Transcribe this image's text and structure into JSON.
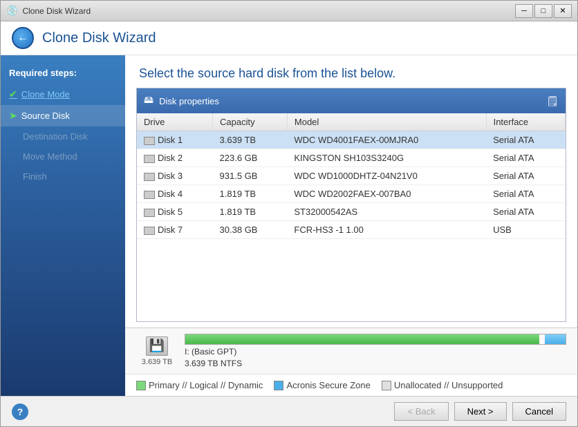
{
  "titlebar": {
    "title": "Clone Disk Wizard",
    "icon": "💿",
    "min_btn": "─",
    "max_btn": "□",
    "close_btn": "✕"
  },
  "app_header": {
    "title": "Clone Disk Wizard"
  },
  "sidebar": {
    "header": "Required steps:",
    "items": [
      {
        "id": "clone-mode",
        "label": "Clone Mode",
        "state": "done"
      },
      {
        "id": "source-disk",
        "label": "Source Disk",
        "state": "active"
      },
      {
        "id": "destination-disk",
        "label": "Destination Disk",
        "state": "disabled"
      },
      {
        "id": "move-method",
        "label": "Move Method",
        "state": "disabled"
      },
      {
        "id": "finish",
        "label": "Finish",
        "state": "disabled"
      }
    ]
  },
  "content": {
    "header": "Select the source hard disk from the list below.",
    "panel_title": "Disk properties",
    "table": {
      "columns": [
        "Drive",
        "Capacity",
        "Model",
        "Interface"
      ],
      "rows": [
        {
          "drive": "Disk 1",
          "capacity": "3.639 TB",
          "model": "WDC WD4001FAEX-00MJRA0",
          "interface": "Serial ATA"
        },
        {
          "drive": "Disk 2",
          "capacity": "223.6 GB",
          "model": "KINGSTON SH103S3240G",
          "interface": "Serial ATA"
        },
        {
          "drive": "Disk 3",
          "capacity": "931.5 GB",
          "model": "WDC WD1000DHTZ-04N21V0",
          "interface": "Serial ATA"
        },
        {
          "drive": "Disk 4",
          "capacity": "1.819 TB",
          "model": "WDC WD2002FAEX-007BA0",
          "interface": "Serial ATA"
        },
        {
          "drive": "Disk 5",
          "capacity": "1.819 TB",
          "model": "ST32000542AS",
          "interface": "Serial ATA"
        },
        {
          "drive": "Disk 7",
          "capacity": "30.38 GB",
          "model": "FCR-HS3 -1 1.00",
          "interface": "USB"
        }
      ]
    },
    "disk_display": {
      "size": "3.639 TB",
      "label": "I: (Basic GPT)",
      "sublabel": "3.639 TB  NTFS",
      "fill_percent": 93
    },
    "legend": [
      {
        "id": "primary",
        "label": "Primary // Logical // Dynamic",
        "color": "primary"
      },
      {
        "id": "acronis",
        "label": "Acronis Secure Zone",
        "color": "acronis"
      },
      {
        "id": "unalloc",
        "label": "Unallocated // Unsupported",
        "color": "unalloc"
      }
    ]
  },
  "footer": {
    "back_label": "< Back",
    "next_label": "Next >",
    "cancel_label": "Cancel",
    "help_label": "?"
  }
}
